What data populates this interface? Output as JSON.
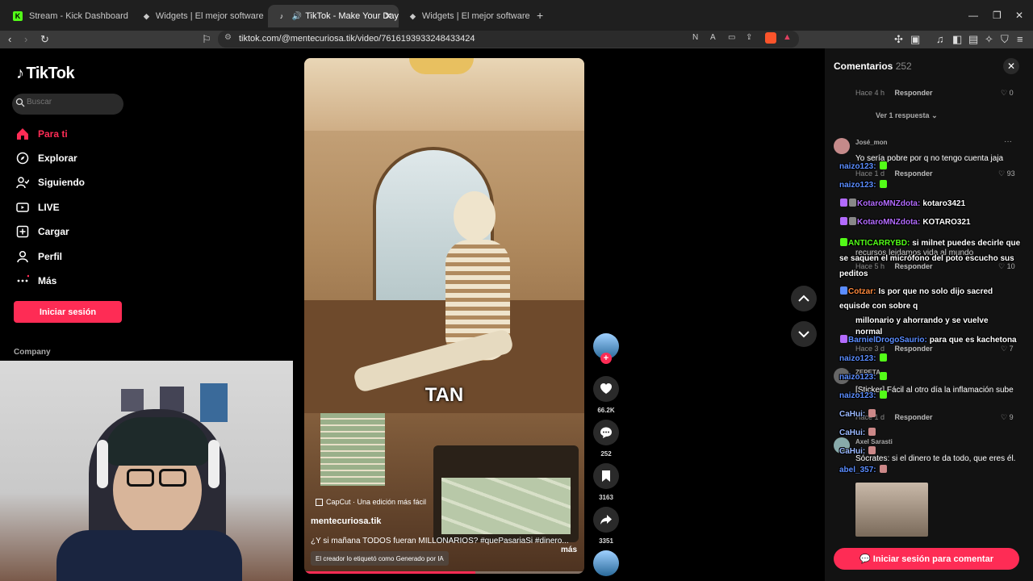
{
  "browser": {
    "tabs": [
      {
        "title": "Stream - Kick Dashboard",
        "favicon": "K",
        "favicon_color": "#53fc18"
      },
      {
        "title": "Widgets | El mejor software para pot",
        "favicon": "◆",
        "favicon_color": "#ffffff"
      },
      {
        "title": "TikTok - Make Your Day",
        "favicon": "♪",
        "favicon_color": "#ffffff"
      },
      {
        "title": "Widgets | El mejor software para pot",
        "favicon": "◆",
        "favicon_color": "#ffffff"
      }
    ],
    "new_tab": "+",
    "url": "tiktok.com/@mentecuriosa.tik/video/7616193933248433424"
  },
  "sidebar": {
    "logo_text": "TikTok",
    "search_placeholder": "Buscar",
    "items": [
      {
        "label": "Para ti",
        "icon": "home-icon"
      },
      {
        "label": "Explorar",
        "icon": "compass-icon"
      },
      {
        "label": "Siguiendo",
        "icon": "following-icon"
      },
      {
        "label": "LIVE",
        "icon": "live-icon"
      },
      {
        "label": "Cargar",
        "icon": "upload-icon"
      },
      {
        "label": "Perfil",
        "icon": "profile-icon"
      },
      {
        "label": "Más",
        "icon": "more-icon"
      }
    ],
    "login_label": "Iniciar sesión",
    "company_label": "Company"
  },
  "video": {
    "caption_word": "TAN",
    "capcut_label": "CapCut · Una edición más fácil",
    "author": "mentecuriosa.tik",
    "description": "¿Y si mañana TODOS fueran MILLONARIOS? #quePasariaSi #dinero...",
    "more_label": "más",
    "ai_label": "El creador lo etiquetó como Generado por IA",
    "progress": 0.61
  },
  "actions": {
    "likes": "66.2K",
    "comments": "252",
    "saves": "3163",
    "shares": "3351"
  },
  "comments_panel": {
    "title": "Comentarios",
    "count": "252",
    "top_meta": "Hace 4 h",
    "reply_label": "Responder",
    "top_likes": "0",
    "view_replies": "Ver 1 respuesta",
    "comments": [
      {
        "user": "José_mon",
        "text": "Yo sería pobre por q no tengo cuenta jaja",
        "meta": "Hace 1 d",
        "likes": "93"
      },
      {
        "user": "",
        "text": "recursos lejdamos vida al mundo",
        "meta": "Hace 5 h",
        "likes": "10"
      },
      {
        "user": "",
        "text": "",
        "meta": "Hace 3 d",
        "likes": "7"
      },
      {
        "user": "ZEPETA",
        "text": "[Sticker] Fácil al otro día la inflamación sube",
        "meta": "Hace 1 d",
        "likes": "9"
      },
      {
        "user": "Axel Sarasti",
        "text": "Sócrates: si el dinero te da todo, que eres él.",
        "meta": "",
        "likes": ""
      }
    ],
    "cta": "Iniciar sesión para comentar"
  },
  "chat": [
    {
      "user": "naizo123:",
      "color": "#5b8dff",
      "msg": ""
    },
    {
      "user": "naizo123:",
      "color": "#5b8dff",
      "msg": ""
    },
    {
      "user": "KotaroMNZdota:",
      "color": "#b36bff",
      "msg": "kotaro3421"
    },
    {
      "user": "KotaroMNZdota:",
      "color": "#b36bff",
      "msg": "KOTARO321"
    },
    {
      "user": "ANTICARRYBD:",
      "color": "#53fc18",
      "msg": "si milnet puedes decirle que se saquen el micrófono del poto escucho sus peditos"
    },
    {
      "user": "Cotzar:",
      "color": "#ff8a3d",
      "msg": "Is por que no solo dijo sacred equisde con sobre q"
    },
    {
      "user": "",
      "color": "#ffffff",
      "msg": "millonario y ahorrando y se vuelve normal"
    },
    {
      "user": "BarnielDrogoSaurio:",
      "color": "#5b8dff",
      "msg": "para que es kachetona"
    },
    {
      "user": "naizo123:",
      "color": "#5b8dff",
      "msg": ""
    },
    {
      "user": "naizo123:",
      "color": "#5b8dff",
      "msg": ""
    },
    {
      "user": "naizo123:",
      "color": "#5b8dff",
      "msg": ""
    },
    {
      "user": "CaHui:",
      "color": "#9ab8ff",
      "msg": ""
    },
    {
      "user": "CaHui:",
      "color": "#9ab8ff",
      "msg": ""
    },
    {
      "user": "CaHui:",
      "color": "#9ab8ff",
      "msg": ""
    },
    {
      "user": "abel_357:",
      "color": "#5b8dff",
      "msg": ""
    }
  ],
  "colors": {
    "accent": "#fe2c55",
    "panel": "#121212",
    "tab_active": "#3a3a3a"
  }
}
